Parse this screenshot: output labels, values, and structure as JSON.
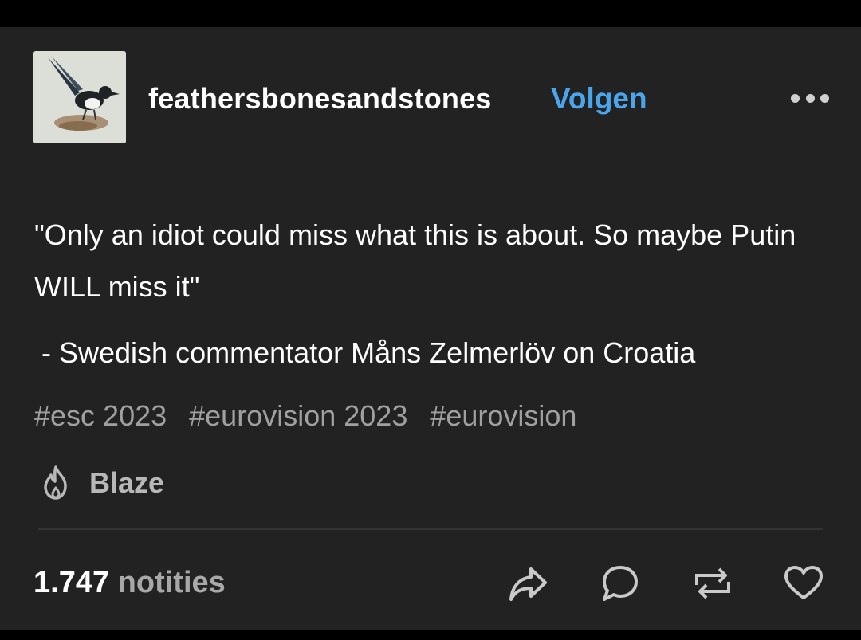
{
  "post": {
    "username": "feathersbonesandstones",
    "follow_label": "Volgen",
    "quote": "\"Only an idiot could miss what this is about. So maybe Putin WILL miss it\"",
    "attribution": " - Swedish commentator Måns Zelmerlöv on Croatia",
    "tags": [
      "#esc 2023",
      "#eurovision 2023",
      "#eurovision"
    ],
    "blaze_label": "Blaze",
    "notes_count": "1.747",
    "notes_label": "notities"
  },
  "icons": {
    "more": "more-icon",
    "blaze": "flame-icon",
    "share": "share-icon",
    "reply": "reply-icon",
    "reblog": "reblog-icon",
    "like": "heart-icon"
  },
  "colors": {
    "background": "#222222",
    "text": "#ffffff",
    "muted": "#a0a0a0",
    "accent": "#4aa5ec"
  }
}
